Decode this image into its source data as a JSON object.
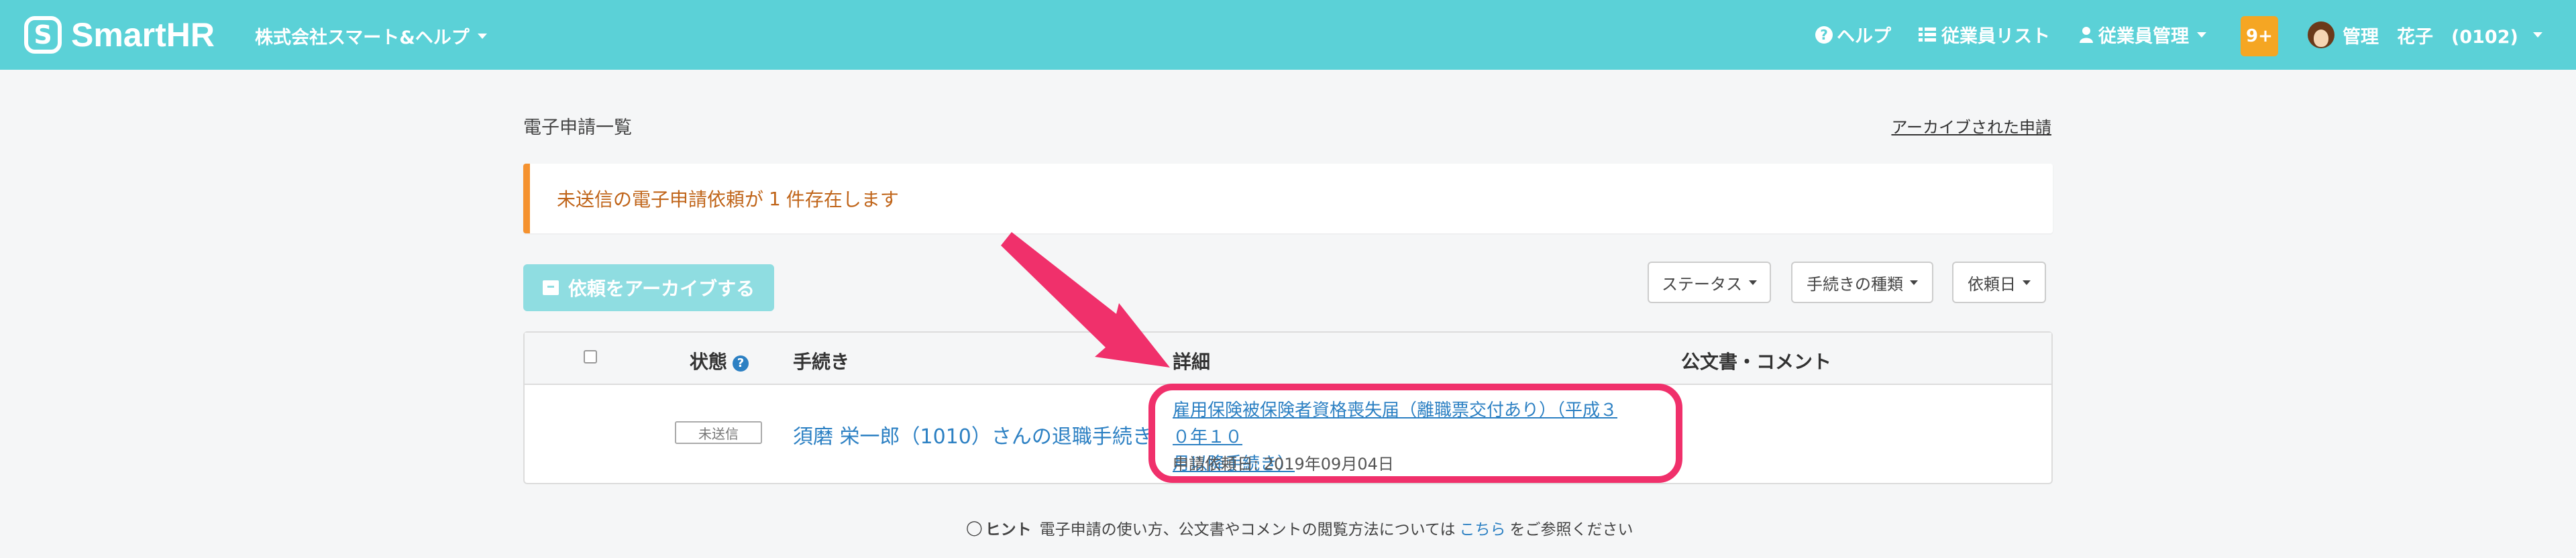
{
  "header": {
    "logo_text": "SmartHR",
    "company": "株式会社スマート&ヘルプ",
    "nav": {
      "help": "ヘルプ",
      "employee_list": "従業員リスト",
      "employee_manage": "従業員管理",
      "notifications": "9+",
      "user": "管理　花子　(0102)"
    }
  },
  "page": {
    "title": "電子申請一覧",
    "archived_link": "アーカイブされた申請"
  },
  "alert": {
    "prefix": "未送信の電子申請依頼が",
    "count": "1",
    "suffix": "件存在します"
  },
  "toolbar": {
    "archive_button": "依頼をアーカイブする",
    "filters": [
      "ステータス",
      "手続きの種類",
      "依頼日"
    ]
  },
  "table": {
    "headers": {
      "status": "状態",
      "procedure": "手続き",
      "detail": "詳細",
      "documents": "公文書・コメント"
    },
    "rows": [
      {
        "status": "未送信",
        "procedure": "須磨 栄一郎（1010）さんの退職手続き",
        "detail_line1": "雇用保険被保険者資格喪失届（離職票交付あり）（平成３０年１０",
        "detail_line2": "月以降手続き）",
        "request_date": "申請依頼日: 2019年09月04日"
      }
    ]
  },
  "hint": {
    "label": "ヒント",
    "text_before": "電子申請の使い方、公文書やコメントの閲覧方法については",
    "link": "こちら",
    "text_after": "をご参照ください"
  },
  "colors": {
    "header_bg": "#5bd1d7",
    "link": "#2c80c3",
    "alert_border": "#f5922f",
    "highlight": "#f0306b",
    "badge": "#f5a623"
  },
  "icons": {
    "help": "question-circle-icon",
    "list": "list-icon",
    "person": "person-icon",
    "archive": "archive-box-icon",
    "hint": "lightbulb-icon"
  }
}
